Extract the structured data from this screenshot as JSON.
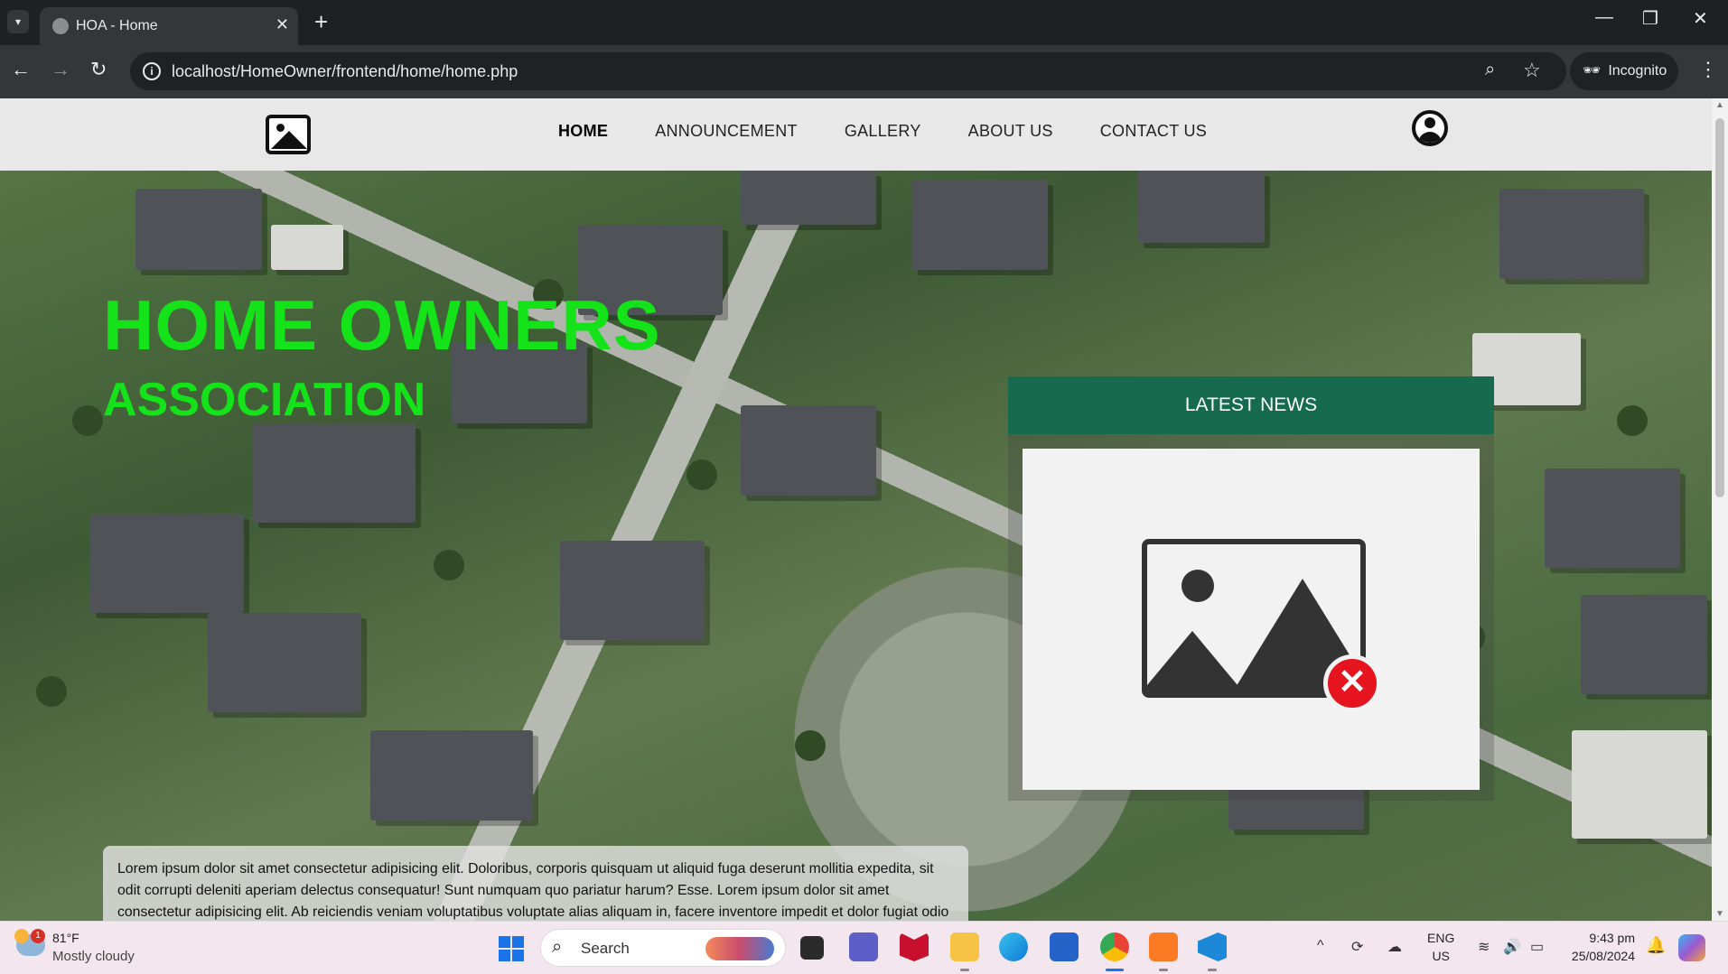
{
  "browser": {
    "tab_title": "HOA - Home",
    "tab_close": "✕",
    "new_tab": "+",
    "url": "localhost/HomeOwner/frontend/home/home.php",
    "incognito_label": "Incognito",
    "window_controls": {
      "minimize": "—",
      "restore": "❐",
      "close": "✕"
    },
    "nav": {
      "back": "←",
      "forward": "→",
      "reload": "↻"
    },
    "icons": [
      "info-icon",
      "zoom-icon",
      "star-icon",
      "incognito-icon",
      "kebab-menu-icon"
    ]
  },
  "site": {
    "nav_items": [
      {
        "label": "HOME",
        "active": true
      },
      {
        "label": "ANNOUNCEMENT",
        "active": false
      },
      {
        "label": "GALLERY",
        "active": false
      },
      {
        "label": "ABOUT US",
        "active": false
      },
      {
        "label": "CONTACT US",
        "active": false
      }
    ],
    "hero_title_line1": "HOME OWNERS",
    "hero_title_line2": "ASSOCIATION",
    "title_color": "#14e31a",
    "latest_news_heading": "LATEST NEWS",
    "news_header_color": "#166b4f",
    "news_image_icon": "broken-image-icon",
    "intro_text": "Lorem ipsum dolor sit amet consectetur adipisicing elit. Doloribus, corporis quisquam ut aliquid fuga deserunt mollitia expedita, sit odit corrupti deleniti aperiam delectus consequatur! Sunt numquam quo pariatur harum? Esse. Lorem ipsum dolor sit amet consectetur adipisicing elit. Ab reiciendis veniam voluptatibus voluptate alias aliquam in, facere inventore impedit et dolor fugiat odio possimus. Quia dolore accusantium repellendus soluta quibusdam? Lorem, ipsum dolor sit amet consectetur adipisicing elit. Optio, sed! Iusto, repellendus id magnam quibusdam dignissimos alias sequi consequatur, doloremque dicta quo perspiciatis cumque eos earum odio laborum odit laudantium?"
  },
  "taskbar": {
    "weather_temp": "81°F",
    "weather_condition": "Mostly cloudy",
    "weather_badge": "1",
    "search_label": "Search",
    "lang_line1": "ENG",
    "lang_line2": "US",
    "time": "9:43 pm",
    "date": "25/08/2024",
    "apps": [
      "file-manager",
      "teams",
      "mcafee",
      "file-explorer",
      "edge",
      "store",
      "chrome",
      "xampp",
      "vscode"
    ]
  }
}
